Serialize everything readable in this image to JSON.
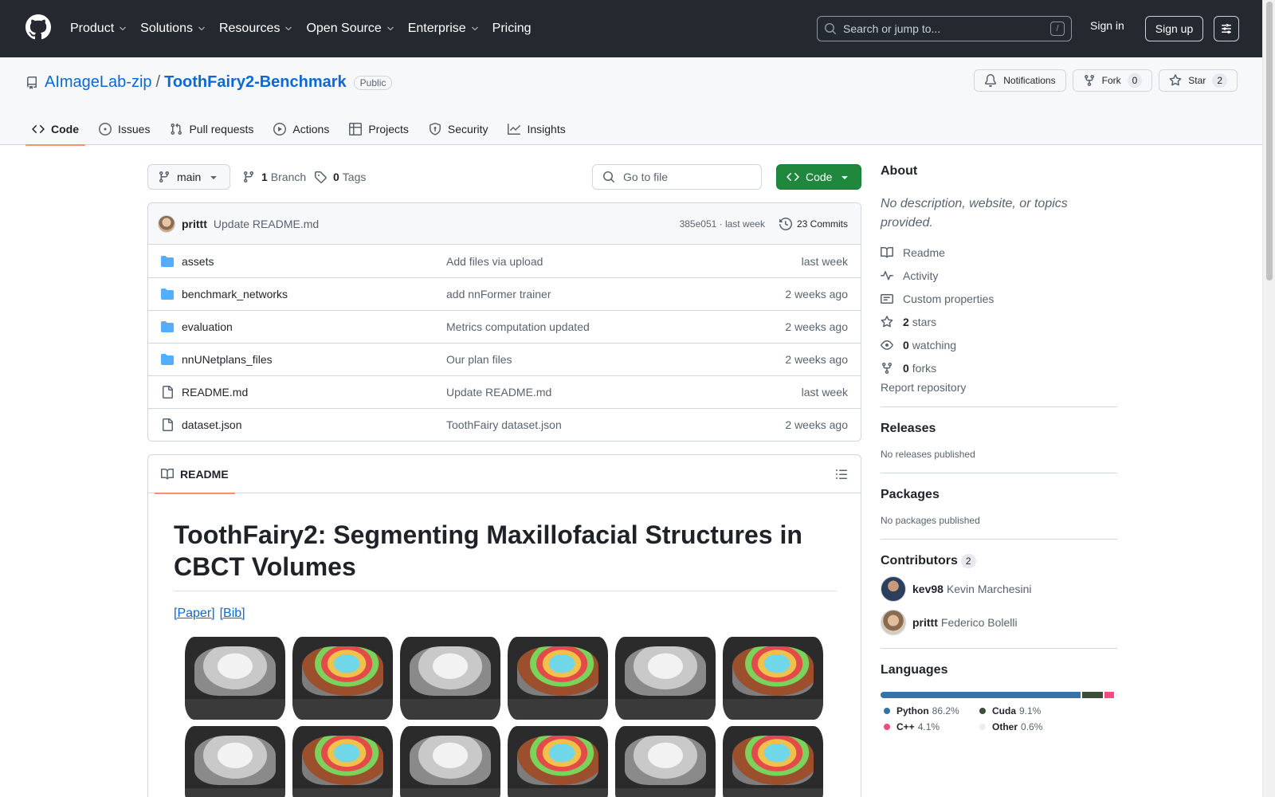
{
  "header": {
    "nav": [
      "Product",
      "Solutions",
      "Resources",
      "Open Source",
      "Enterprise",
      "Pricing"
    ],
    "search_placeholder": "Search or jump to...",
    "search_kbd": "/",
    "signin": "Sign in",
    "signup": "Sign up"
  },
  "repo": {
    "owner": "AImageLab-zip",
    "sep": "/",
    "name": "ToothFairy2-Benchmark",
    "visibility": "Public",
    "notifications": "Notifications",
    "fork_label": "Fork",
    "fork_count": "0",
    "star_label": "Star",
    "star_count": "2",
    "tabs": [
      "Code",
      "Issues",
      "Pull requests",
      "Actions",
      "Projects",
      "Security",
      "Insights"
    ]
  },
  "toolbar": {
    "branch": "main",
    "branches_count": "1",
    "branches_label": "Branch",
    "tags_count": "0",
    "tags_label": "Tags",
    "goto_placeholder": "Go to file",
    "code_label": "Code"
  },
  "commit": {
    "author": "prittt",
    "message": "Update README.md",
    "meta": "385e051 · last week",
    "commits": "23 Commits"
  },
  "files": [
    {
      "type": "dir",
      "name": "assets",
      "message": "Add files via upload",
      "date": "last week"
    },
    {
      "type": "dir",
      "name": "benchmark_networks",
      "message": "add nnFormer trainer",
      "date": "2 weeks ago"
    },
    {
      "type": "dir",
      "name": "evaluation",
      "message": "Metrics computation updated",
      "date": "2 weeks ago"
    },
    {
      "type": "dir",
      "name": "nnUNetplans_files",
      "message": "Our plan files",
      "date": "2 weeks ago"
    },
    {
      "type": "file",
      "name": "README.md",
      "message": "Update README.md",
      "date": "last week"
    },
    {
      "type": "file",
      "name": "dataset.json",
      "message": "ToothFairy dataset.json",
      "date": "2 weeks ago"
    }
  ],
  "readme": {
    "tab": "README",
    "title": "ToothFairy2: Segmenting Maxillofacial Structures in CBCT Volumes",
    "link_paper": "[Paper]",
    "link_bib": "[Bib]"
  },
  "sidebar": {
    "about_title": "About",
    "description": "No description, website, or topics provided.",
    "readme": "Readme",
    "activity": "Activity",
    "custom_properties": "Custom properties",
    "stars_count": "2",
    "stars_label": "stars",
    "watching_count": "0",
    "watching_label": "watching",
    "forks_count": "0",
    "forks_label": "forks",
    "report": "Report repository",
    "releases_title": "Releases",
    "releases_text": "No releases published",
    "packages_title": "Packages",
    "packages_text": "No packages published",
    "contributors_title": "Contributors",
    "contributors_count": "2",
    "contributors": [
      {
        "login": "kev98",
        "name": "Kevin Marchesini"
      },
      {
        "login": "prittt",
        "name": "Federico Bolelli"
      }
    ],
    "languages_title": "Languages",
    "languages": [
      {
        "name": "Python",
        "percent": "86.2%",
        "value": 86.2,
        "color": "#3572A5"
      },
      {
        "name": "Cuda",
        "percent": "9.1%",
        "value": 9.1,
        "color": "#3A4E3A"
      },
      {
        "name": "C++",
        "percent": "4.1%",
        "value": 4.1,
        "color": "#f34b7d"
      },
      {
        "name": "Other",
        "percent": "0.6%",
        "value": 0.6,
        "color": "#ededed"
      }
    ]
  }
}
